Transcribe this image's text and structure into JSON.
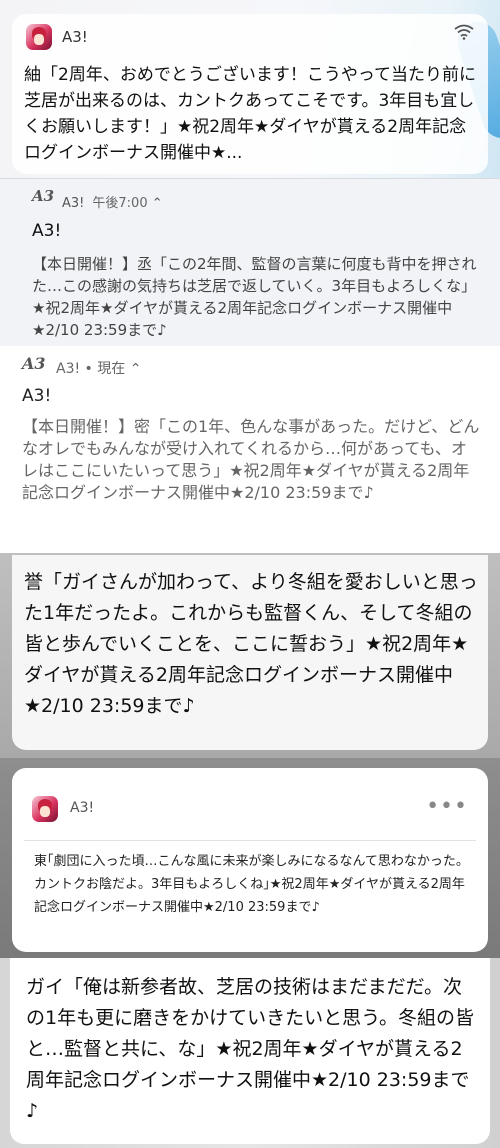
{
  "notif1": {
    "app_name": "A3!",
    "body": "紬「2周年、おめでとうございます！こうやって当たり前に芝居が出来るのは、カントクあってこそです。3年目も宜しくお願いします！」★祝2周年★ダイヤが貰える2周年記念ログインボーナス開催中★..."
  },
  "notif2": {
    "logo": "A3",
    "app_name": "A3!",
    "time": "午後7:00",
    "chevron": "⌃",
    "title": "A3!",
    "body": "【本日開催！】丞「この2年間、監督の言葉に何度も背中を押された…この感謝の気持ちは芝居で返していく。3年目もよろしくな」★祝2周年★ダイヤが貰える2周年記念ログインボーナス開催中★2/10 23:59まで♪"
  },
  "notif3": {
    "logo": "A3",
    "header": "A3! • 現在 ⌃",
    "title": "A3!",
    "body": "【本日開催！】密「この1年、色んな事があった。だけど、どんなオレでもみんなが受け入れてくれるから…何があっても、オレはここにいたいって思う」★祝2周年★ダイヤが貰える2周年記念ログインボーナス開催中★2/10 23:59まで♪"
  },
  "notif4": {
    "body": "誉「ガイさんが加わって、より冬組を愛おしいと思った1年だったよ。これからも監督くん、そして冬組の皆と歩んでいくことを、ここに誓おう」★祝2周年★ダイヤが貰える2周年記念ログインボーナス開催中★2/10 23:59まで♪"
  },
  "notif5": {
    "app_name": "A3!",
    "more": "•••",
    "body": "東｢劇団に入った頃…こんな風に未来が楽しみになるなんて思わなかった。カントクお陰だよ。3年目もよろしくね｣★祝2周年★ダイヤが貰える2周年記念ログインボーナス開催中★2/10 23:59まで♪"
  },
  "notif6": {
    "body": "ガイ「俺は新参者故、芝居の技術はまだまだだ。次の1年も更に磨きをかけていきたいと思う。冬組の皆と…監督と共に、な」★祝2周年★ダイヤが貰える2周年記念ログインボーナス開催中★2/10 23:59まで♪"
  },
  "icons": {
    "wifi": "wifi-icon",
    "app": "a3-app-icon",
    "more": "more-icon"
  }
}
